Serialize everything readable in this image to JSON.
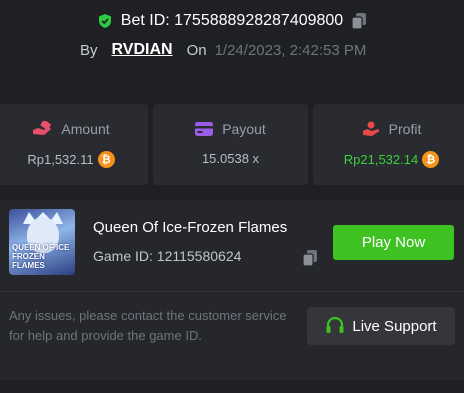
{
  "bet": {
    "id_text": "Bet ID: 1755888928287409800",
    "by_label": "By",
    "username": "RVDIAN",
    "on_label": "On",
    "datetime": "1/24/2023, 2:42:53 PM"
  },
  "stats": {
    "amount": {
      "label": "Amount",
      "value": "Rp1,532.11",
      "icon": "hand-coin-icon",
      "icon_color": "#e8506a"
    },
    "payout": {
      "label": "Payout",
      "value": "15.0538 x",
      "icon": "card-icon",
      "icon_color": "#9b5de5"
    },
    "profit": {
      "label": "Profit",
      "value": "Rp21,532.14",
      "icon": "hand-coin-icon",
      "icon_color": "#e84a4a",
      "value_color": "#3bd13a"
    }
  },
  "currency_icon": "bitcoin-icon",
  "game": {
    "title": "Queen Of Ice-Frozen Flames",
    "id_text": "Game ID: 12115580624",
    "thumbnail_text": "QUEEN OF ICE FROZEN FLAMES",
    "play_label": "Play Now",
    "support_text": "Any issues, please contact the customer service for help and provide the game ID.",
    "support_label": "Live Support"
  },
  "colors": {
    "background": "#1e2024",
    "card": "#292b30",
    "accent_green": "#3dc222",
    "shield_green": "#2ecc40"
  }
}
